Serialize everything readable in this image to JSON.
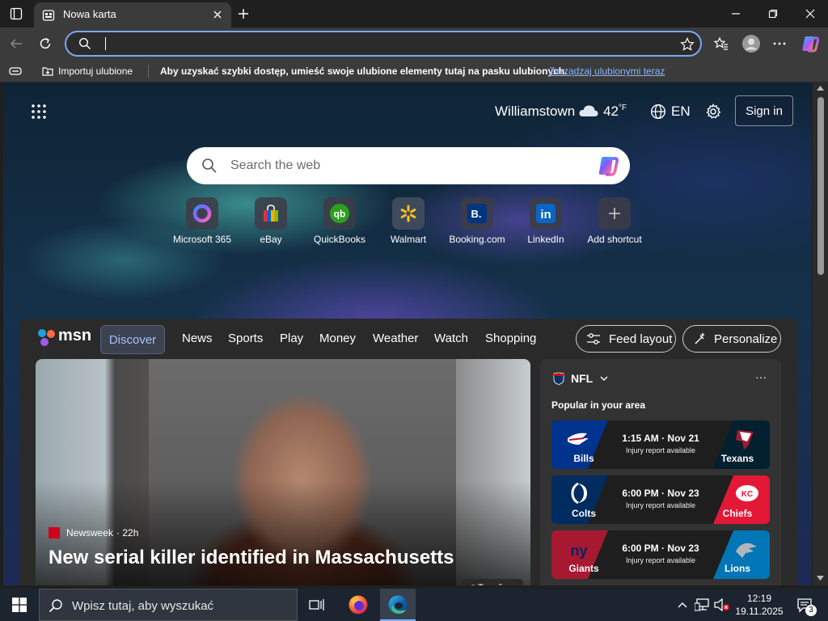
{
  "browser": {
    "tab_title": "Nowa karta",
    "address_value": ""
  },
  "favorites_bar": {
    "import_label": "Importuj ulubione",
    "message": "Aby uzyskać szybki dostęp, umieść swoje ulubione elementy tutaj na pasku ulubionych.",
    "manage_link": "Zarządzaj ulubionymi teraz"
  },
  "newtab": {
    "weather": {
      "city": "Williamstown",
      "temp": "42",
      "unit": "°F"
    },
    "language": "EN",
    "sign_in": "Sign in",
    "search_placeholder": "Search the web",
    "shortcuts": [
      {
        "label": "Microsoft 365",
        "icon": "microsoft-365-icon"
      },
      {
        "label": "eBay",
        "icon": "ebay-icon"
      },
      {
        "label": "QuickBooks",
        "icon": "quickbooks-icon"
      },
      {
        "label": "Walmart",
        "icon": "walmart-icon"
      },
      {
        "label": "Booking.com",
        "icon": "booking-icon"
      },
      {
        "label": "LinkedIn",
        "icon": "linkedin-icon"
      },
      {
        "label": "Add shortcut",
        "icon": "plus-icon"
      }
    ]
  },
  "msn": {
    "logo": "msn",
    "tabs": [
      "Discover",
      "News",
      "Sports",
      "Play",
      "Money",
      "Weather",
      "Watch",
      "Shopping"
    ],
    "active_tab": "Discover",
    "feed_layout": "Feed layout",
    "personalize": "Personalize",
    "hero": {
      "source": "Newsweek",
      "age": "· 22h",
      "title": "New serial killer identified in Massachusetts",
      "trending": "↗ Trending"
    },
    "nfl": {
      "title": "NFL",
      "subtitle": "Popular in your area",
      "games": [
        {
          "home": "Bills",
          "away": "Texans",
          "time": "1:15 AM · Nov 21",
          "note": "Injury report available",
          "home_color": "#00338d",
          "away_color": "#03202f"
        },
        {
          "home": "Colts",
          "away": "Chiefs",
          "time": "6:00 PM · Nov 23",
          "note": "Injury report available",
          "home_color": "#002c5f",
          "away_color": "#e31837"
        },
        {
          "home": "Giants",
          "away": "Lions",
          "time": "6:00 PM · Nov 23",
          "note": "Injury report available",
          "home_color": "#a71930",
          "away_color": "#0076b6"
        }
      ]
    }
  },
  "taskbar": {
    "search_placeholder": "Wpisz tutaj, aby wyszukać",
    "time": "12:19",
    "date": "19.11.2025",
    "notifications": "3"
  }
}
